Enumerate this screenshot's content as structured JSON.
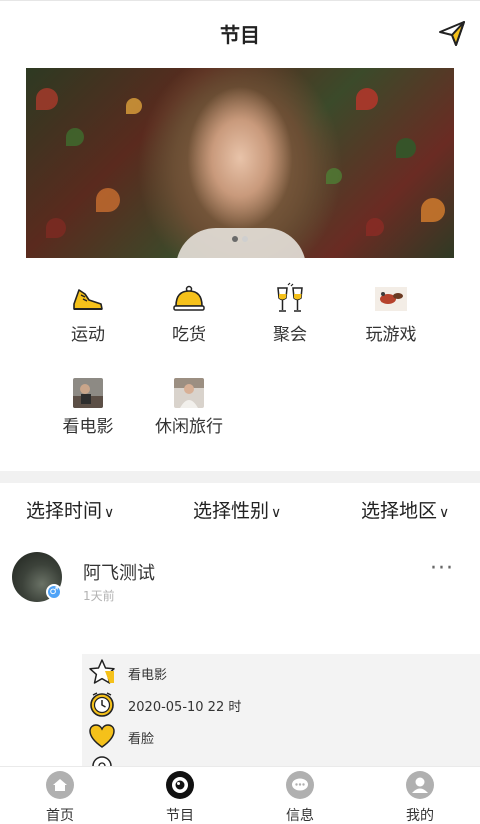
{
  "header": {
    "title": "节目",
    "send_icon": "paper-plane-icon"
  },
  "banner": {
    "image": "woman-among-autumn-leaves-photo",
    "page_count": 2,
    "current_page": 1
  },
  "categories": [
    {
      "label": "运动",
      "icon": "sneaker-icon"
    },
    {
      "label": "吃货",
      "icon": "food-cloche-icon"
    },
    {
      "label": "聚会",
      "icon": "champagne-glasses-icon"
    },
    {
      "label": "玩游戏",
      "icon": "game-thumbnail"
    },
    {
      "label": "看电影",
      "icon": "movie-thumbnail"
    },
    {
      "label": "休闲旅行",
      "icon": "travel-thumbnail"
    }
  ],
  "filters": [
    {
      "label": "选择时间"
    },
    {
      "label": "选择性别"
    },
    {
      "label": "选择地区"
    }
  ],
  "post": {
    "username": "阿飞测试",
    "time": "1天前",
    "gender_icon": "male-icon",
    "details": [
      {
        "icon": "star-icon",
        "text": "看电影"
      },
      {
        "icon": "clock-icon",
        "text": "2020-05-10 22 时"
      },
      {
        "icon": "heart-icon",
        "text": "看脸"
      },
      {
        "icon": "location-icon",
        "text": ""
      }
    ]
  },
  "tabbar": [
    {
      "label": "首页",
      "icon": "home-icon"
    },
    {
      "label": "节目",
      "icon": "eye-icon"
    },
    {
      "label": "信息",
      "icon": "chat-icon"
    },
    {
      "label": "我的",
      "icon": "user-icon"
    }
  ],
  "colors": {
    "accent": "#f5c11a",
    "tab_icon": "#b0b0b0",
    "separator": "#f1f1f1"
  }
}
